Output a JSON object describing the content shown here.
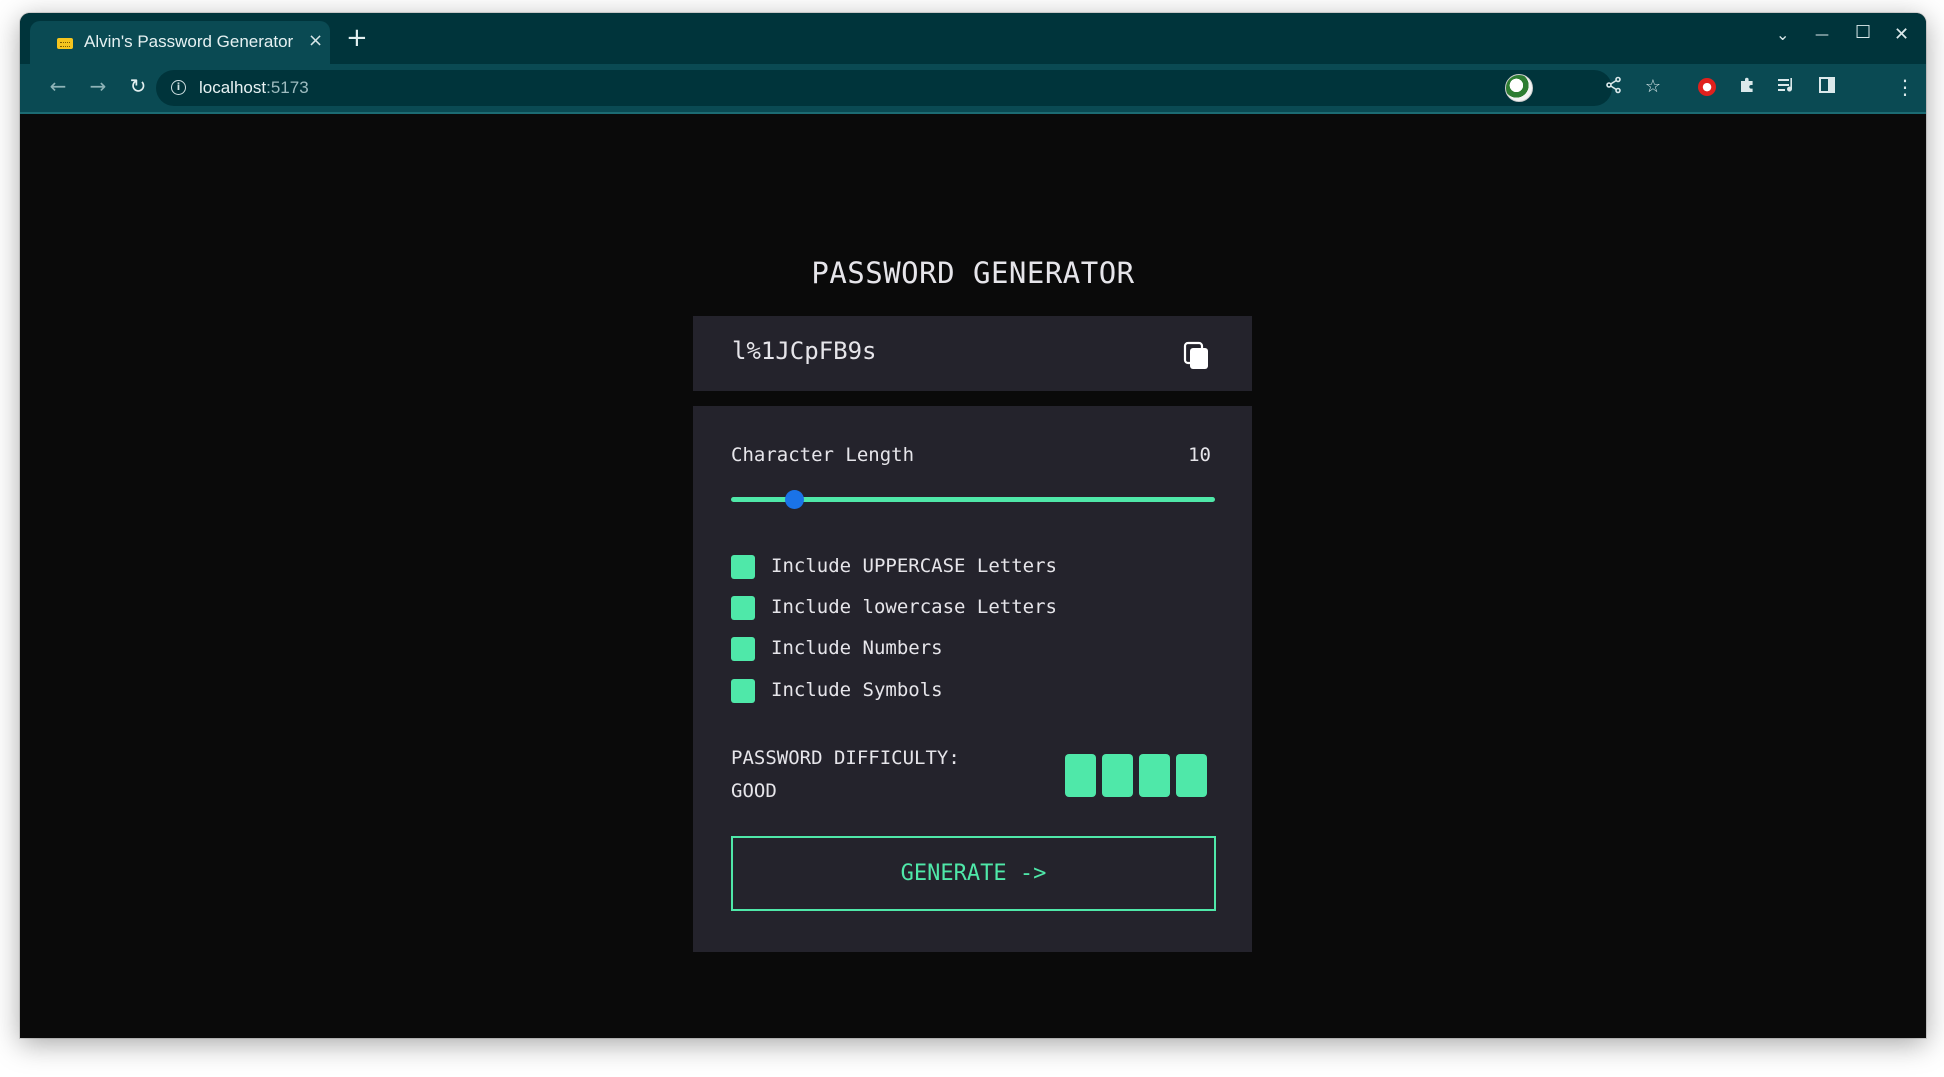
{
  "browser": {
    "tab_title": "Alvin's Password Generator",
    "tab_close_icon": "×",
    "new_tab_icon": "+",
    "url_host": "localhost",
    "url_port": ":5173",
    "window_controls": {
      "tab_search": "⌄",
      "minimize": "—",
      "maximize": "☐",
      "close": "✕"
    },
    "nav": {
      "back": "←",
      "forward": "→",
      "reload": "↻"
    },
    "icons": [
      "share-icon",
      "star-icon",
      "extension-red-icon",
      "puzzle-icon",
      "media-icon",
      "side-panel-icon",
      "avatar",
      "menu-icon"
    ]
  },
  "app": {
    "title": "PASSWORD GENERATOR",
    "password": "l%1JCpFB9s",
    "length_label": "Character Length",
    "length_value": "10",
    "slider_fraction": 0.13,
    "options": [
      {
        "label": "Include UPPERCASE Letters",
        "checked": true
      },
      {
        "label": "Include lowercase Letters",
        "checked": true
      },
      {
        "label": "Include Numbers",
        "checked": true
      },
      {
        "label": "Include Symbols",
        "checked": true
      }
    ],
    "difficulty_label": "PASSWORD DIFFICULTY:",
    "difficulty_value": "GOOD",
    "strength_filled": 4,
    "generate_label": "GENERATE ->",
    "colors": {
      "accent": "#4fe8a9",
      "panel": "#24232c",
      "background": "#0a0a0a",
      "slider_thumb": "#1a73e8"
    }
  }
}
